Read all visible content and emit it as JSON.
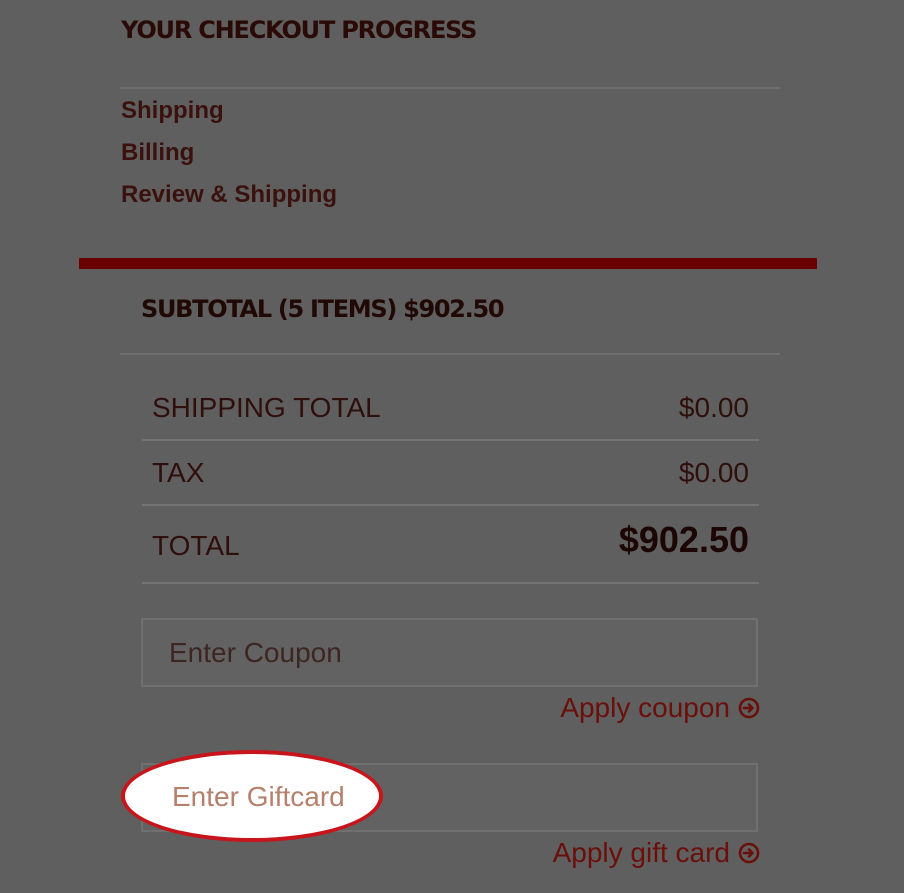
{
  "checkout_progress": {
    "title": "YOUR CHECKOUT PROGRESS",
    "steps": [
      {
        "label": "Shipping"
      },
      {
        "label": "Billing"
      },
      {
        "label": "Review & Shipping"
      }
    ]
  },
  "summary": {
    "subtotal_heading": "SUBTOTAL (5 ITEMS) $902.50",
    "rows": [
      {
        "label": "SHIPPING TOTAL",
        "value": "$0.00"
      },
      {
        "label": "TAX",
        "value": "$0.00"
      },
      {
        "label": "TOTAL",
        "value": "$902.50"
      }
    ]
  },
  "coupon": {
    "value": "",
    "placeholder": "Enter Coupon",
    "apply_label": "Apply coupon",
    "apply_icon": "circle-arrow-right-icon"
  },
  "giftcard": {
    "value": "",
    "placeholder": "Enter Giftcard",
    "apply_label": "Apply gift card",
    "apply_icon": "circle-arrow-right-icon"
  },
  "colors": {
    "overlay_background": "#5f5f5f",
    "accent": "#6b0000",
    "link": "#6a0f0a",
    "highlight_border": "#c8141b"
  }
}
